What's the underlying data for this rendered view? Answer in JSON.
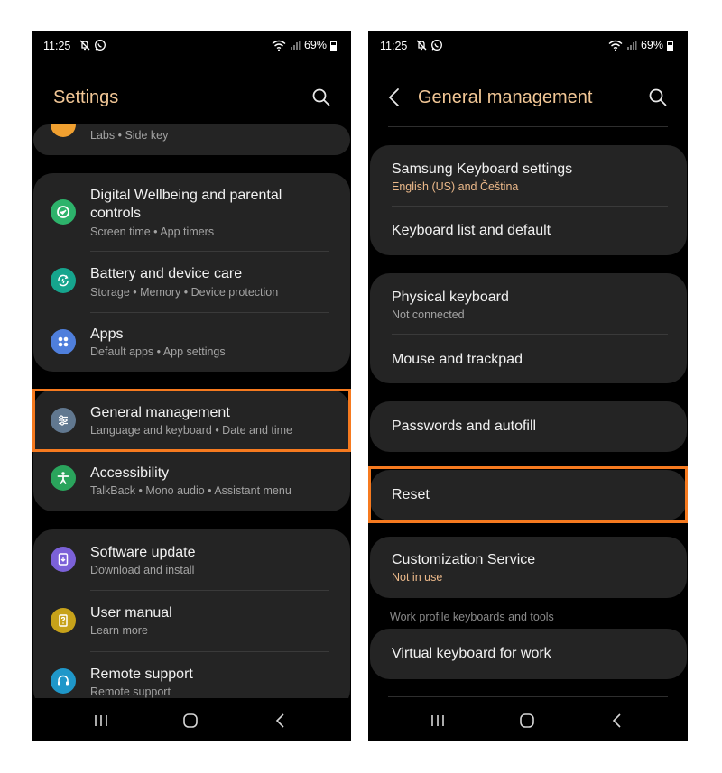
{
  "status": {
    "time": "11:25",
    "battery": "69%"
  },
  "left": {
    "header": {
      "title": "Settings"
    },
    "partial_item": {
      "subtitle_parts": [
        "Labs",
        "Side key"
      ]
    },
    "items": [
      {
        "title_line1": "Digital Wellbeing and parental",
        "title_line2": "controls",
        "subtitle_parts": [
          "Screen time",
          "App timers"
        ],
        "icon": "digital-wellbeing-icon",
        "color": "#2db36b"
      },
      {
        "title": "Battery and device care",
        "subtitle_parts": [
          "Storage",
          "Memory",
          "Device protection"
        ],
        "icon": "battery-care-icon",
        "color": "#16a58e"
      },
      {
        "title": "Apps",
        "subtitle_parts": [
          "Default apps",
          "App settings"
        ],
        "icon": "apps-icon",
        "color": "#4f7fdc"
      },
      {
        "title": "General management",
        "subtitle_parts": [
          "Language and keyboard",
          "Date and time"
        ],
        "icon": "general-management-icon",
        "color": "#617890"
      },
      {
        "title": "Accessibility",
        "subtitle_parts": [
          "TalkBack",
          "Mono audio",
          "Assistant menu"
        ],
        "icon": "accessibility-icon",
        "color": "#2aa45c"
      },
      {
        "title": "Software update",
        "subtitle_parts": [
          "Download and install"
        ],
        "icon": "software-update-icon",
        "color": "#7b61d8"
      },
      {
        "title": "User manual",
        "subtitle_parts": [
          "Learn more"
        ],
        "icon": "user-manual-icon",
        "color": "#c7a21a"
      },
      {
        "title": "Remote support",
        "subtitle_parts": [
          "Remote support"
        ],
        "icon": "remote-support-icon",
        "color": "#1f97c9"
      }
    ]
  },
  "right": {
    "header": {
      "title": "General management"
    },
    "items": [
      {
        "title": "Samsung Keyboard settings",
        "subtitle": "English (US) and Čeština"
      },
      {
        "title": "Keyboard list and default"
      },
      {
        "title": "Physical keyboard",
        "subtitle": "Not connected"
      },
      {
        "title": "Mouse and trackpad"
      },
      {
        "title": "Passwords and autofill"
      },
      {
        "title": "Reset"
      },
      {
        "title": "Customization Service",
        "subtitle": "Not in use"
      },
      {
        "title": "Virtual keyboard for work"
      }
    ],
    "section_label": "Work profile keyboards and tools"
  },
  "colors": {
    "accent": "#f2c796",
    "highlight": "#f67a1f",
    "card": "#242424",
    "orange_subtitle": "#ecb98a"
  }
}
